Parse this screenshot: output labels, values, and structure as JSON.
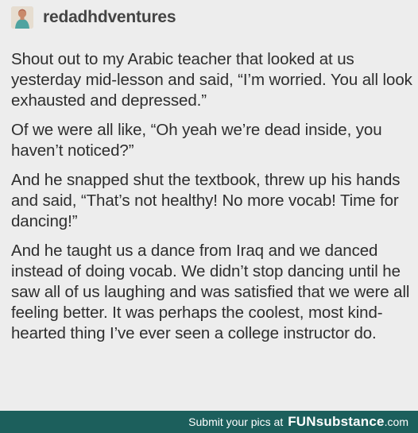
{
  "post": {
    "username": "redadhdventures",
    "avatar_icon": "avatar-icon",
    "paragraphs": [
      "Shout out to my Arabic teacher that looked at us yesterday mid-lesson and said, “I’m worried. You all look exhausted and depressed.”",
      "Of we were all like, “Oh yeah we’re dead inside, you haven’t noticed?”",
      "And he snapped shut the textbook, threw up his hands and said, “That’s not healthy! No more vocab! Time for dancing!”",
      "And he taught us a dance from Iraq and we danced instead of doing vocab. We didn’t stop dancing until he saw all of us laughing and was satisfied that we were all feeling better. It was perhaps the coolest, most kind-hearted thing I’ve ever seen a college instructor do."
    ]
  },
  "footer": {
    "submit_text": "Submit your pics at",
    "brand": "FUNsubstance",
    "brand_suffix": ".com",
    "background_color": "#1c5f5c"
  }
}
